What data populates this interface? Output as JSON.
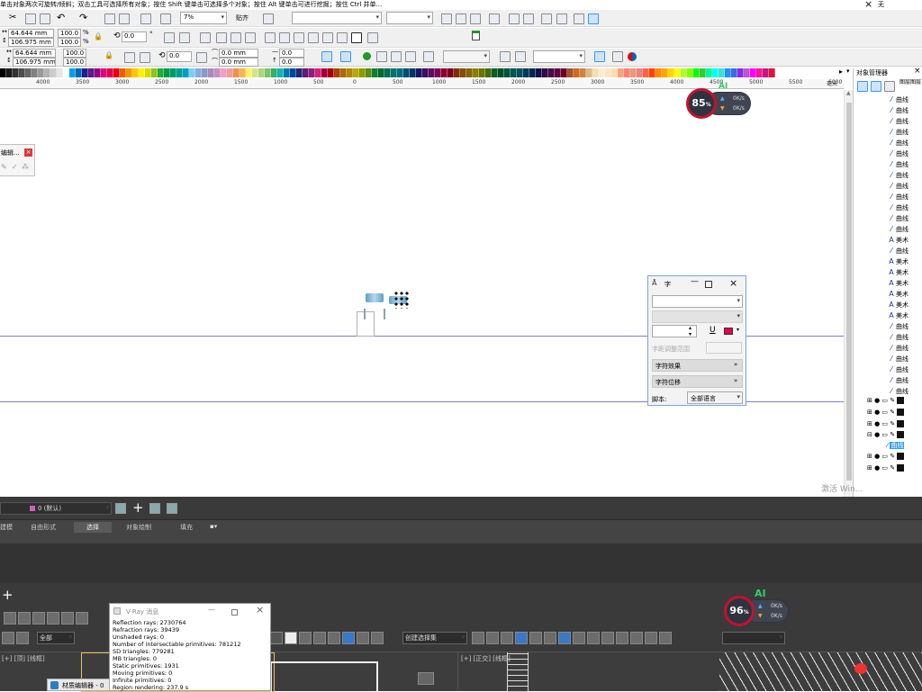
{
  "status_hint": "单击对象两次可旋转/倾斜；双击工具可选择所有对象；按住 Shift 键单击可选择多个对象；按住 Alt 键单击可进行挖掘；按住 Ctrl 并单...",
  "window_controls": {
    "close": "×",
    "extra": "无"
  },
  "toolbar1": {
    "zoom_value": "7%",
    "snap_label": "贴齐"
  },
  "propbar": {
    "x": "64.644 mm",
    "y": "106.975 mm",
    "scale_x": "100.0",
    "scale_y": "100.0",
    "percent": "%",
    "angle": "0.0",
    "degree": "°",
    "x2": "64.644 mm",
    "y2": "106.975 mm",
    "scale_x2": "100.0",
    "scale_y2": "100.0",
    "angle2": "0.0",
    "pos_a": "0.0 mm",
    "pos_b": "0.0 mm",
    "val_a": "0.0",
    "val_b": "0.0"
  },
  "palette": [
    "#000000",
    "#1a1a1a",
    "#333333",
    "#4d4d4d",
    "#666666",
    "#808080",
    "#999999",
    "#b3b3b3",
    "#cccccc",
    "#e6e6e6",
    "#ffffff",
    "#00a0e9",
    "#0068b7",
    "#1d2088",
    "#601986",
    "#920783",
    "#e4007f",
    "#e5004f",
    "#e60012",
    "#eb6100",
    "#f39800",
    "#fcc800",
    "#fff100",
    "#cfdb00",
    "#8fc31f",
    "#22ac38",
    "#009944",
    "#009b6b",
    "#009e96",
    "#00a0c1",
    "#7ecef4",
    "#88abda",
    "#8c97cb",
    "#aa89bd",
    "#c490bf",
    "#f19ec2",
    "#f29c9f",
    "#f19149",
    "#f8b551",
    "#fff45c",
    "#d7e38b",
    "#aed580",
    "#80c269",
    "#31b16c",
    "#13b5b1",
    "#0075a9",
    "#00479d",
    "#1d2a73",
    "#5f1d6f",
    "#8e1e82",
    "#d8207a",
    "#a40035",
    "#a5000f",
    "#a84200",
    "#ac6a00",
    "#b28500",
    "#b7aa00",
    "#8c9a00",
    "#5b8b14",
    "#0d7f33",
    "#006934",
    "#006e54",
    "#00736d",
    "#006c7e",
    "#004d71",
    "#003567",
    "#1b1464",
    "#3e0f5f",
    "#5f0c5d",
    "#7e0059",
    "#910028",
    "#7d0022",
    "#7e3100",
    "#825000",
    "#866400",
    "#8a8000",
    "#6a7500",
    "#456a0f",
    "#0a6025",
    "#005027",
    "#005340",
    "#005652",
    "#00515f",
    "#003a55",
    "#00284d",
    "#13104b",
    "#2e0b47",
    "#470a46",
    "#5f0043",
    "#6d001e",
    "#a0522d",
    "#d2691e",
    "#cd853f",
    "#deb887",
    "#f5deb3",
    "#faebd7",
    "#ffe4c4",
    "#ffdead",
    "#ffa07a",
    "#fa8072",
    "#e9967a",
    "#f08080",
    "#ff6347",
    "#ff4500",
    "#ff8c00",
    "#ffa500",
    "#ffd700",
    "#ffff00",
    "#adff2f",
    "#7fff00",
    "#00ff00",
    "#32cd32",
    "#00fa9a",
    "#00ffff",
    "#40e0d0",
    "#1e90ff",
    "#4169e1",
    "#8a2be2",
    "#ba55d3",
    "#ff00ff",
    "#ff1493",
    "#c71585",
    "#dc143c"
  ],
  "ruler": {
    "ticks": [
      "4000",
      "3500",
      "3000",
      "2500",
      "2000",
      "1500",
      "1000",
      "500",
      "0",
      "500",
      "1000",
      "1500",
      "2000",
      "2500",
      "3000",
      "3500",
      "4000",
      "4500",
      "5000",
      "5500",
      "6000"
    ],
    "unit": "毫米"
  },
  "object_manager": {
    "title": "对象管理器",
    "header_right": "图层图层",
    "items": [
      {
        "glyph": "curve",
        "label": "曲线"
      },
      {
        "glyph": "curve",
        "label": "曲线"
      },
      {
        "glyph": "curve",
        "label": "曲线"
      },
      {
        "glyph": "curve",
        "label": "曲线"
      },
      {
        "glyph": "curve",
        "label": "曲线"
      },
      {
        "glyph": "curve",
        "label": "曲线"
      },
      {
        "glyph": "curve",
        "label": "曲线"
      },
      {
        "glyph": "curve",
        "label": "曲线"
      },
      {
        "glyph": "curve",
        "label": "曲线"
      },
      {
        "glyph": "curve",
        "label": "曲线"
      },
      {
        "glyph": "curve",
        "label": "曲线"
      },
      {
        "glyph": "curve",
        "label": "曲线"
      },
      {
        "glyph": "curve",
        "label": "曲线"
      },
      {
        "glyph": "A",
        "label": "美术"
      },
      {
        "glyph": "curve",
        "label": "曲线"
      },
      {
        "glyph": "A",
        "label": "美术"
      },
      {
        "glyph": "A",
        "label": "美术"
      },
      {
        "glyph": "A",
        "label": "美术"
      },
      {
        "glyph": "A",
        "label": "美术"
      },
      {
        "glyph": "A",
        "label": "美术"
      },
      {
        "glyph": "A",
        "label": "美术"
      },
      {
        "glyph": "curve",
        "label": "曲线"
      },
      {
        "glyph": "curve",
        "label": "曲线"
      },
      {
        "glyph": "curve",
        "label": "曲线"
      },
      {
        "glyph": "curve",
        "label": "曲线"
      },
      {
        "glyph": "curve",
        "label": "曲线"
      },
      {
        "glyph": "curve",
        "label": "曲线"
      },
      {
        "glyph": "curve",
        "label": "曲线"
      }
    ],
    "selected_label": "曲线"
  },
  "net_widget_top": {
    "percent": "85",
    "unit": "%",
    "up": "0K/s",
    "down": "0K/s",
    "ai": "AI"
  },
  "net_widget_bottom": {
    "percent": "96",
    "unit": "%",
    "up": "0K/s",
    "down": "0K/s",
    "ai": "AI"
  },
  "edit_panel": {
    "title": "编辑..."
  },
  "char_panel": {
    "title": "字",
    "range_label": "字距调整范围",
    "effects_label": "字符效果",
    "offset_label": "字符位移",
    "script_label": "脚本:",
    "script_value": "全部语言"
  },
  "activate_hint": "激活 Win...",
  "max_top": {
    "layer_value": "0 (默认)",
    "tabs": [
      "建模",
      "自由形式",
      "选择",
      "对象绘制",
      "填充"
    ],
    "active_tab": "选择"
  },
  "max_toolbar": {
    "all_label": "全部",
    "sel_set_label": "创建选择集"
  },
  "vray": {
    "title": "V-Ray 消息",
    "lines": [
      "Reflection rays: 2730764",
      "Refraction rays: 39439",
      "Unshaded rays: 0",
      "Number of intersectable primitives: 781212",
      "SD triangles: 779281",
      "MB triangles: 0",
      "Static primitives: 1931",
      "Moving primitives: 0",
      "Infinite primitives: 0",
      "Region rendering: 237.9 s"
    ]
  },
  "viewports": {
    "left_label": "[+] [顶] [线框]",
    "right_label": "[+] [正交] [线框]"
  },
  "material_editor": {
    "label": "材质编辑器 - 0"
  },
  "colors": {
    "canvas_bg": "#ffffff",
    "toolbar_bg": "#f0f0f0",
    "max_bg": "#3c3c3c",
    "accent": "#3399ff",
    "guide": "#8080c0"
  }
}
